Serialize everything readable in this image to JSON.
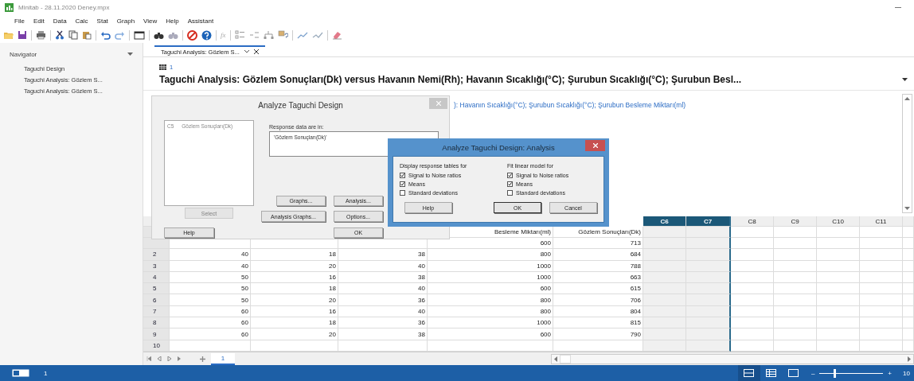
{
  "window": {
    "title": "Minitab - 28.11.2020 Deney.mpx"
  },
  "menu": [
    "File",
    "Edit",
    "Data",
    "Calc",
    "Stat",
    "Graph",
    "View",
    "Help",
    "Assistant"
  ],
  "toolbar": {
    "formula_label": "fx"
  },
  "navigator": {
    "title": "Navigator",
    "items": [
      "Taguchi Design",
      "Taguchi Analysis: Gözlem S...",
      "Taguchi Analysis: Gözlem S..."
    ]
  },
  "output_tab": {
    "label": "Taguchi Analysis: Gözlem S..."
  },
  "output": {
    "worksheet_ref": "1",
    "heading": "Taguchi Analysis: Gözlem Sonuçları(Dk) versus Havanın Nemi(Rh); Havanın Sıcaklığı(°C); Şurubun Sıcaklığı(°C); Şurubun Besl...",
    "line": "): Havanın Sıcaklığı(°C); Şurubun Sıcaklığı(°C); Şurubun  Besleme Miktarı(ml)"
  },
  "worksheet": {
    "columns": [
      {},
      {},
      {},
      {
        "name": "Besleme Miktarı(ml)"
      },
      {
        "name": "Gözlem Sonuçları(Dk)"
      },
      {
        "header": "C6",
        "selected": true
      },
      {
        "header": "C7",
        "selected": true
      },
      {
        "header": "C8",
        "selected": false
      },
      {
        "header": "C9",
        "selected": false
      },
      {
        "header": "C10",
        "selected": false
      },
      {
        "header": "C11",
        "selected": false
      }
    ],
    "rows": [
      {
        "cells": [
          null,
          null,
          null,
          "600",
          "713"
        ]
      },
      {
        "number": "2",
        "cells": [
          "40",
          "18",
          "38",
          "800",
          "684"
        ]
      },
      {
        "number": "3",
        "cells": [
          "40",
          "20",
          "40",
          "1000",
          "788"
        ]
      },
      {
        "number": "4",
        "cells": [
          "50",
          "16",
          "38",
          "1000",
          "663"
        ]
      },
      {
        "number": "5",
        "cells": [
          "50",
          "18",
          "40",
          "600",
          "615"
        ]
      },
      {
        "number": "6",
        "cells": [
          "50",
          "20",
          "36",
          "800",
          "706"
        ]
      },
      {
        "number": "7",
        "cells": [
          "60",
          "16",
          "40",
          "800",
          "804"
        ]
      },
      {
        "number": "8",
        "cells": [
          "60",
          "18",
          "36",
          "1000",
          "815"
        ]
      },
      {
        "number": "9",
        "cells": [
          "60",
          "20",
          "38",
          "600",
          "790"
        ]
      },
      {
        "number": "10",
        "cells": []
      }
    ],
    "sheet_tabs": [
      {
        "label": "1",
        "selected": true
      }
    ]
  },
  "design_dialog": {
    "title": "Analyze Taguchi Design",
    "list_items": [
      {
        "column": "C5",
        "name": "Gözlem Sonuçları(Dk)"
      }
    ],
    "response_label": "Response data are in:",
    "response_value": "'Gözlem Sonuçları(Dk)'",
    "buttons": [
      {
        "label": "Select",
        "disabled": true
      },
      {
        "label": "Graphs...",
        "disabled": false
      },
      {
        "label": "Analysis...",
        "disabled": false
      },
      {
        "label": "Analysis Graphs...",
        "disabled": false
      },
      {
        "label": "Options...",
        "disabled": false
      },
      {
        "label": "Help",
        "disabled": false
      },
      {
        "label": "OK",
        "disabled": false
      }
    ]
  },
  "analysis_dialog": {
    "title": "Analyze Taguchi Design: Analysis",
    "groups": [
      {
        "title": "Display response tables for",
        "options": [
          {
            "label": "Signal to Noise ratios",
            "checked": true
          },
          {
            "label": "Means",
            "checked": true
          },
          {
            "label": "Standard deviations",
            "checked": false
          }
        ]
      },
      {
        "title": "Fit linear model for",
        "options": [
          {
            "label": "Signal to Noise ratios",
            "checked": true
          },
          {
            "label": "Means",
            "checked": true
          },
          {
            "label": "Standard deviations",
            "checked": false
          }
        ]
      }
    ],
    "buttons": [
      {
        "label": "Help",
        "default": false
      },
      {
        "label": "OK",
        "default": true
      },
      {
        "label": "Cancel",
        "default": false
      }
    ]
  },
  "status_bar": {
    "sheet": "1",
    "zoom_out": "–",
    "zoom_in": "+",
    "level": 0.22,
    "zoom": "10"
  }
}
